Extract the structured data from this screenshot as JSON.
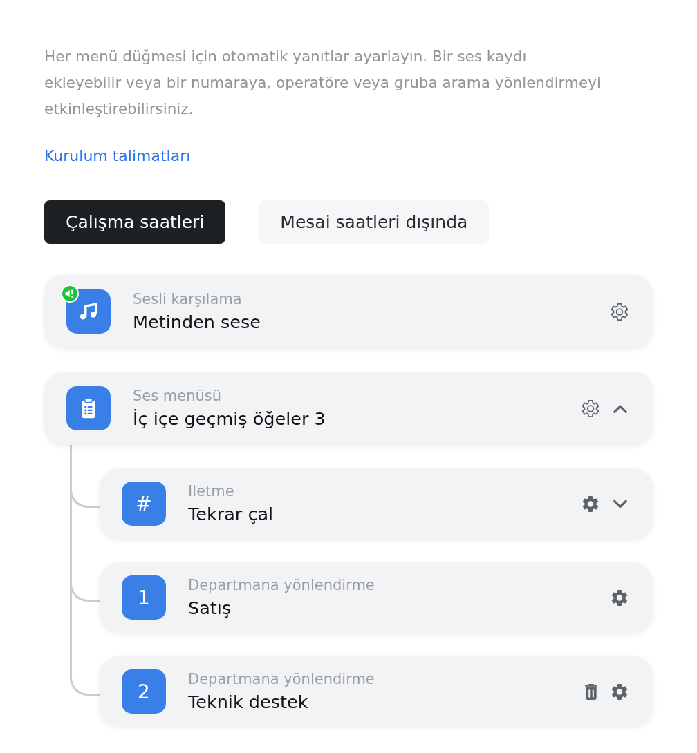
{
  "intro": {
    "text": "Her menü düğmesi için otomatik yanıtlar ayarlayın. Bir ses kaydı ekleyebilir veya bir numaraya, operatöre veya gruba arama yönlendirmeyi etkinleştirebilirsiniz.",
    "link": "Kurulum talimatları"
  },
  "tabs": [
    {
      "label": "Çalışma saatleri",
      "selected": true
    },
    {
      "label": "Mesai saatleri dışında",
      "selected": false
    }
  ],
  "items": [
    {
      "tile": {
        "kind": "music",
        "badge": true
      },
      "subtitle": "Sesli karşılama",
      "title": "Metinden sese",
      "actions": [
        {
          "kind": "settings",
          "filled": false
        }
      ]
    },
    {
      "tile": {
        "kind": "clipboard",
        "badge": false
      },
      "subtitle": "Ses menüsü",
      "title": "İç içe geçmiş öğeler 3",
      "actions": [
        {
          "kind": "settings",
          "filled": false
        },
        {
          "kind": "toggle",
          "expanded": true
        }
      ],
      "children": [
        {
          "tile": {
            "kind": "key",
            "label": "#",
            "badge": false
          },
          "subtitle": "Iletme",
          "title": "Tekrar çal",
          "actions": [
            {
              "kind": "settings",
              "filled": true
            },
            {
              "kind": "toggle",
              "expanded": false
            }
          ]
        },
        {
          "tile": {
            "kind": "key",
            "label": "1",
            "badge": false
          },
          "subtitle": "Departmana yönlendirme",
          "title": "Satış",
          "actions": [
            {
              "kind": "settings",
              "filled": true
            }
          ]
        },
        {
          "tile": {
            "kind": "key",
            "label": "2",
            "badge": false
          },
          "subtitle": "Departmana yönlendirme",
          "title": "Teknik destek",
          "actions": [
            {
              "kind": "delete"
            },
            {
              "kind": "settings",
              "filled": true
            }
          ]
        }
      ]
    }
  ]
}
